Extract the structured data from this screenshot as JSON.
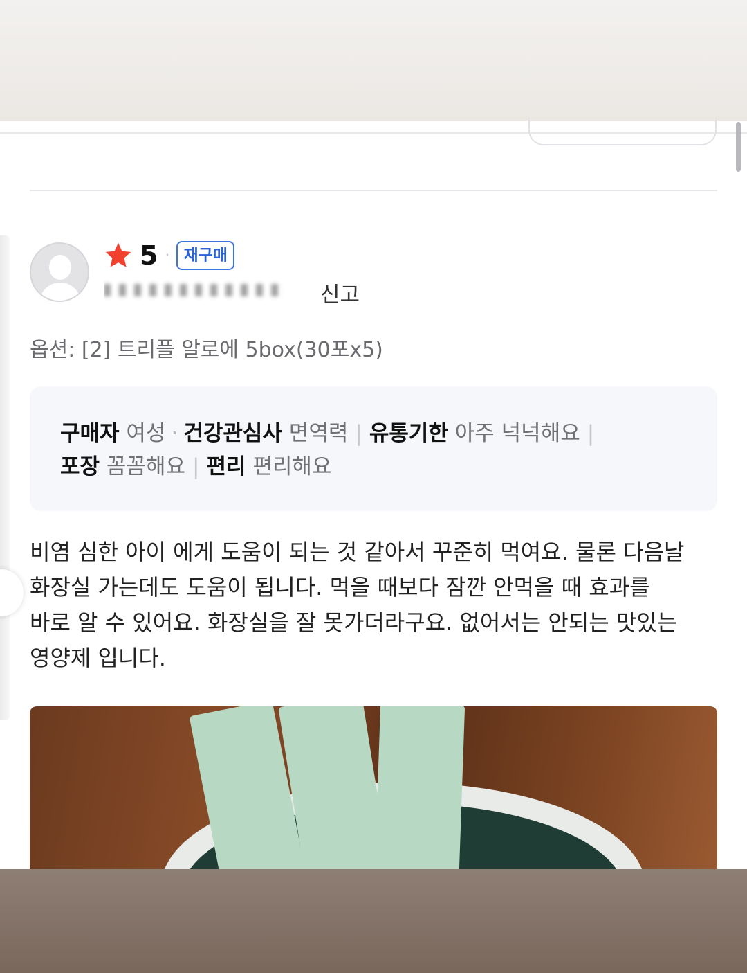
{
  "review": {
    "rating": "5",
    "badge": "재구매",
    "report_label": "신고",
    "option": "옵션: [2] 트리플 알로에 5box(30포x5)",
    "survey": [
      {
        "key": "구매자",
        "value": "여성"
      },
      {
        "key": "건강관심사",
        "value": "면역력"
      },
      {
        "key": "유통기한",
        "value": "아주 넉넉해요"
      },
      {
        "key": "포장",
        "value": "꼼꼼해요"
      },
      {
        "key": "편리",
        "value": "편리해요"
      }
    ],
    "body": "비염 심한 아이 에게 도움이 되는 것 같아서 꾸준히 먹여요. 물론 다음날\n화장실 가는데도 도움이 됩니다. 먹을 때보다 잠깐 안먹을 때 효과를\n바로 알 수 있어요. 화장실을 잘  못가더라구요. 없어서는 안되는 맛있는\n영양제 입니다."
  },
  "icons": {
    "rating": "star-icon",
    "avatar": "default-user-icon"
  },
  "colors": {
    "star": "#f0412e",
    "badge": "#2b62d4"
  }
}
